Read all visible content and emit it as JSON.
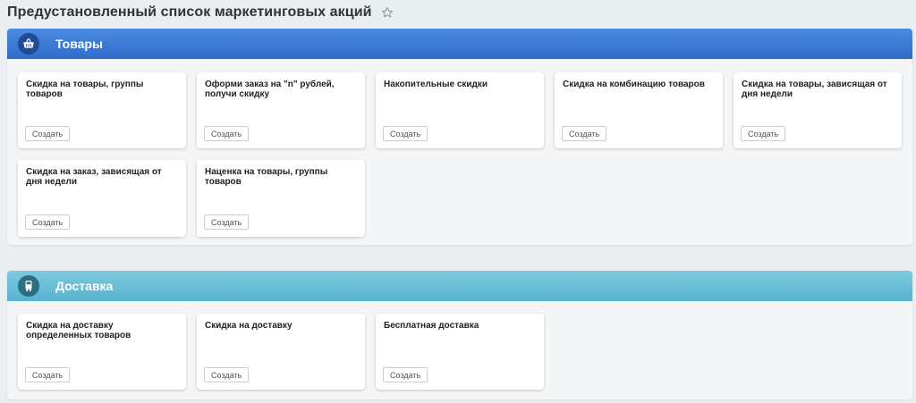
{
  "page": {
    "title": "Предустановленный список маркетинговых акций",
    "star_icon": "star-outline-icon"
  },
  "sections": {
    "goods": {
      "title": "Товары",
      "icon": "basket-icon",
      "color": "#3d7ad6",
      "cards": [
        {
          "title": "Скидка на товары, группы товаров",
          "button": "Создать"
        },
        {
          "title": "Оформи заказ на \"n\" рублей, получи скидку",
          "button": "Создать"
        },
        {
          "title": "Накопительные скидки",
          "button": "Создать"
        },
        {
          "title": "Скидка на комбинацию товаров",
          "button": "Создать"
        },
        {
          "title": "Скидка на товары, зависящая от дня недели",
          "button": "Создать"
        },
        {
          "title": "Скидка на заказ, зависящая от дня недели",
          "button": "Создать"
        },
        {
          "title": "Наценка на товары, группы товаров",
          "button": "Создать"
        }
      ]
    },
    "delivery": {
      "title": "Доставка",
      "icon": "truck-icon",
      "color": "#6bbfd8",
      "cards": [
        {
          "title": "Скидка на доставку определенных товаров",
          "button": "Создать"
        },
        {
          "title": "Скидка на доставку",
          "button": "Создать"
        },
        {
          "title": "Бесплатная доставка",
          "button": "Создать"
        }
      ]
    }
  }
}
